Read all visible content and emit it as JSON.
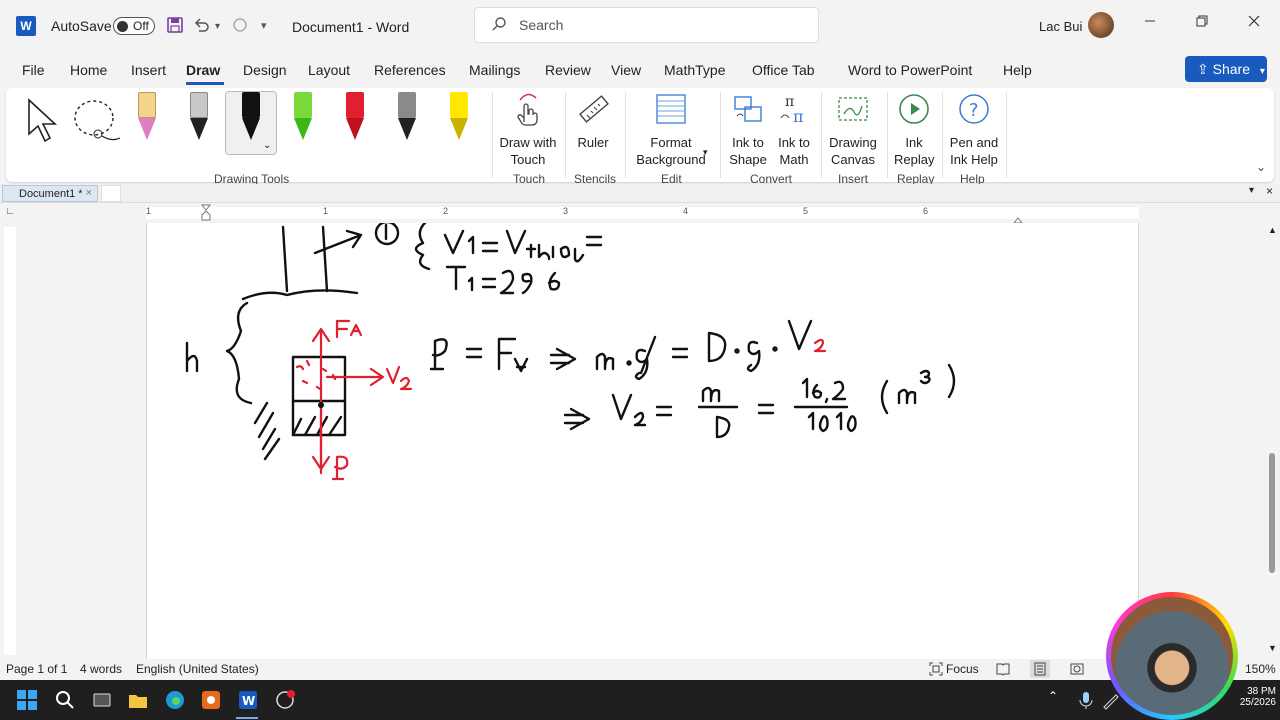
{
  "titlebar": {
    "app_logo": "W",
    "autosave_label": "AutoSave",
    "autosave_state": "Off",
    "doc_title": "Document1  -  Word",
    "search_placeholder": "Search",
    "user_name": "Lac Bui"
  },
  "menu": {
    "items": [
      "File",
      "Home",
      "Insert",
      "Draw",
      "Design",
      "Layout",
      "References",
      "Mailings",
      "Review",
      "View",
      "MathType",
      "Office Tab",
      "Word to PowerPoint",
      "Help"
    ],
    "active": "Draw",
    "share_label": "Share"
  },
  "ribbon": {
    "drawing_tools_label": "Drawing Tools",
    "pens": [
      {
        "name": "pencil-pink",
        "color": "#f4d38a",
        "tip": "#e07fbf"
      },
      {
        "name": "pen-gray-a",
        "color": "#c8c8c8",
        "tip": "#222"
      },
      {
        "name": "pen-black",
        "color": "#111111",
        "tip": "#111"
      },
      {
        "name": "pen-green",
        "color": "#7bd93b",
        "tip": "#3cb814"
      },
      {
        "name": "pen-red",
        "color": "#e0202e",
        "tip": "#c0101c"
      },
      {
        "name": "pen-gray",
        "color": "#8a8a8a",
        "tip": "#222"
      },
      {
        "name": "highlighter-yellow",
        "color": "#ffe800",
        "tip": "#c8b400"
      }
    ],
    "groups": [
      {
        "label": "Touch",
        "buttons": [
          {
            "label": "Draw with Touch"
          }
        ]
      },
      {
        "label": "Stencils",
        "buttons": [
          {
            "label": "Ruler"
          }
        ]
      },
      {
        "label": "Edit",
        "buttons": [
          {
            "label": "Format Background"
          }
        ]
      },
      {
        "label": "Convert",
        "buttons": [
          {
            "label": "Ink to Shape"
          },
          {
            "label": "Ink to Math"
          }
        ]
      },
      {
        "label": "Insert",
        "buttons": [
          {
            "label": "Drawing Canvas"
          }
        ]
      },
      {
        "label": "Replay",
        "buttons": [
          {
            "label": "Ink Replay"
          }
        ]
      },
      {
        "label": "Help",
        "buttons": [
          {
            "label": "Pen and Ink Help"
          }
        ]
      }
    ]
  },
  "tabbar": {
    "doc_tab": "Document1 *"
  },
  "ruler": {
    "numbers": [
      "1",
      "1",
      "2",
      "3",
      "4",
      "5",
      "6"
    ]
  },
  "status": {
    "page": "Page 1 of 1",
    "words": "4 words",
    "language": "English (United States)",
    "focus": "Focus",
    "zoom": "150%"
  },
  "taskbar": {
    "clock_time": "38 PM",
    "clock_date": "25/2026"
  }
}
